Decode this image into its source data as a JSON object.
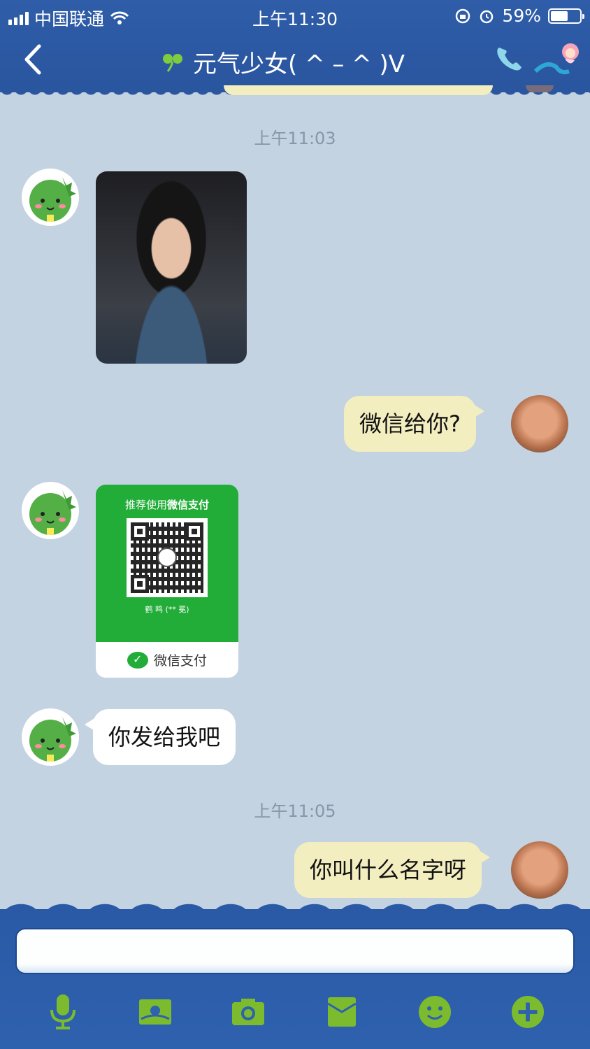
{
  "status_bar": {
    "carrier": "中国联通",
    "time": "上午11:30",
    "battery": "59%",
    "battery_level": 0.59
  },
  "header": {
    "title": "元气少女( ^ – ^ )V"
  },
  "messages": [
    {
      "type": "timestamp",
      "text": "上午11:03"
    },
    {
      "type": "image",
      "sender": "other",
      "description_icon": "photo"
    },
    {
      "type": "text",
      "sender": "me",
      "text": "微信给你?"
    },
    {
      "type": "pay_card",
      "sender": "other",
      "header_prefix": "推荐使用",
      "header_bold": "微信支付",
      "payee": "鹤 鸣 (** 冕)",
      "footer": "微信支付"
    },
    {
      "type": "text",
      "sender": "other",
      "text": "你发给我吧"
    },
    {
      "type": "timestamp",
      "text": "上午11:05"
    },
    {
      "type": "text",
      "sender": "me",
      "text": "你叫什么名字呀"
    }
  ],
  "toolbar": {
    "items": [
      "microphone-icon",
      "image-icon",
      "camera-icon",
      "envelope-icon",
      "emoji-icon",
      "plus-icon"
    ]
  },
  "colors": {
    "header_bg": "#2a559f",
    "chat_bg": "#c4d3e2",
    "outgoing_bubble": "#f3eec0",
    "incoming_bubble": "#ffffff",
    "toolbar_icon": "#7dbb2e",
    "wechat_green": "#22ac38"
  }
}
